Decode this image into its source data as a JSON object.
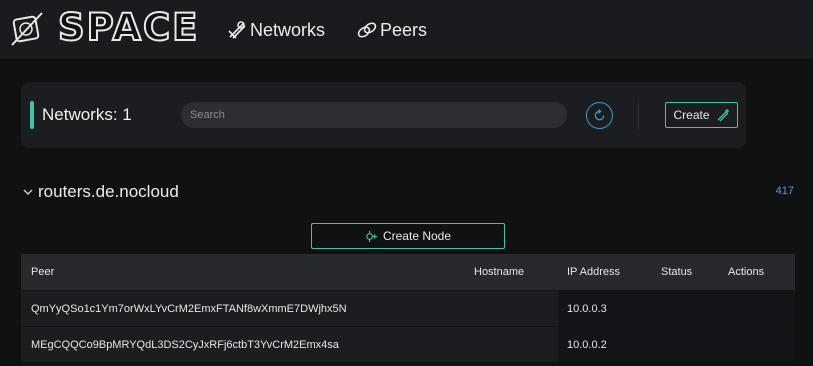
{
  "brand": {
    "name": "SPACE"
  },
  "nav": [
    {
      "label": "Networks",
      "icon": "networks-icon"
    },
    {
      "label": "Peers",
      "icon": "peers-icon"
    }
  ],
  "toolbar": {
    "title": "Networks: 1",
    "search_placeholder": "Search",
    "create_label": "Create"
  },
  "network": {
    "name": "routers.de.nocloud",
    "count": "417",
    "create_node_label": "Create Node"
  },
  "table": {
    "columns": [
      "Peer",
      "Hostname",
      "IP Address",
      "Status",
      "Actions"
    ],
    "rows": [
      {
        "peer": "QmYyQSo1c1Ym7orWxLYvCrM2EmxFTANf8wXmmE7DWjhx5N",
        "hostname": "",
        "ip": "10.0.0.3",
        "status": ""
      },
      {
        "peer": "MEgCQQCo9BpMRYQdL3DS2CyJxRFj6ctbT3YvCrM2Emx4sa",
        "hostname": "",
        "ip": "10.0.0.2",
        "status": ""
      }
    ]
  },
  "colors": {
    "accent": "#3fc6a4",
    "link": "#4aa3df",
    "background": "#101113"
  }
}
